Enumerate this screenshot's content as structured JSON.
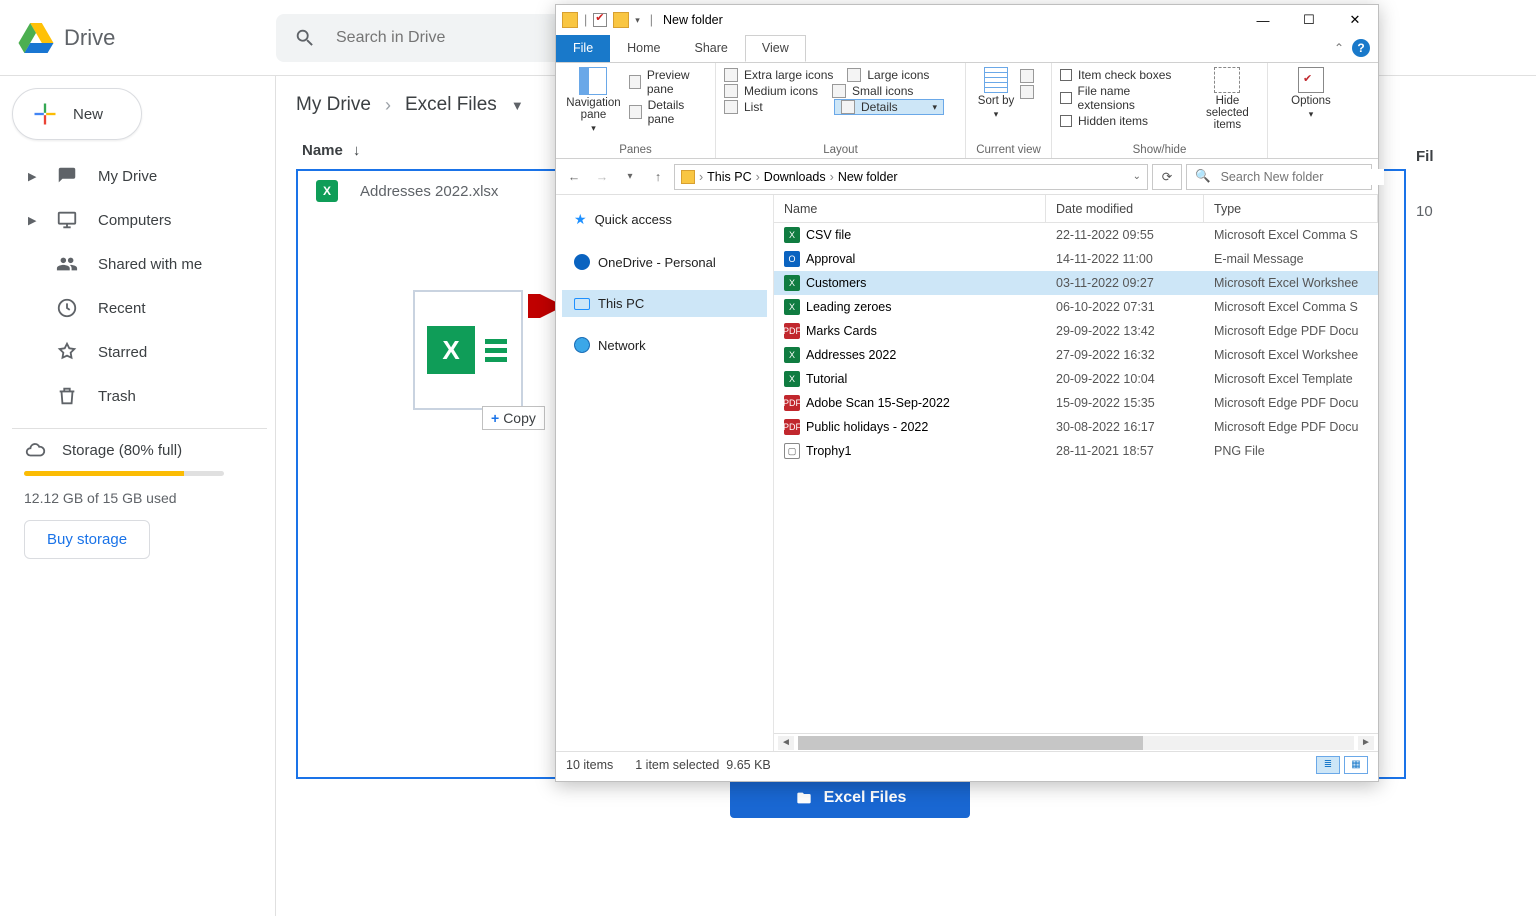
{
  "drive": {
    "brand": "Drive",
    "search_placeholder": "Search in Drive",
    "new_button": "New",
    "nav": {
      "my_drive": "My Drive",
      "computers": "Computers",
      "shared": "Shared with me",
      "recent": "Recent",
      "starred": "Starred",
      "trash": "Trash"
    },
    "storage": {
      "label": "Storage (80% full)",
      "used": "12.12 GB of 15 GB used",
      "buy": "Buy storage",
      "percent": 80
    },
    "crumbs": {
      "root": "My Drive",
      "current": "Excel Files"
    },
    "column_name": "Name",
    "right_col": {
      "header": "Fil",
      "value": "10"
    },
    "file_row": "Addresses 2022.xlsx",
    "drag_copy": "Copy",
    "drop_label": "Excel Files"
  },
  "explorer": {
    "title": "New folder",
    "tabs": {
      "file": "File",
      "home": "Home",
      "share": "Share",
      "view": "View"
    },
    "ribbon": {
      "panes": {
        "nav": "Navigation pane",
        "preview": "Preview pane",
        "details": "Details pane",
        "group": "Panes"
      },
      "layout": {
        "xl": "Extra large icons",
        "lg": "Large icons",
        "md": "Medium icons",
        "sm": "Small icons",
        "list": "List",
        "details": "Details",
        "group": "Layout"
      },
      "current": {
        "sort": "Sort by",
        "group": "Current view"
      },
      "showhide": {
        "checkboxes": "Item check boxes",
        "ext": "File name extensions",
        "hidden": "Hidden items",
        "hidesel": "Hide selected items",
        "group": "Show/hide"
      },
      "options": "Options"
    },
    "breadcrumbs": [
      "This PC",
      "Downloads",
      "New folder"
    ],
    "search_placeholder": "Search New folder",
    "tree": {
      "quick": "Quick access",
      "onedrive": "OneDrive - Personal",
      "thispc": "This PC",
      "network": "Network"
    },
    "columns": {
      "name": "Name",
      "date": "Date modified",
      "type": "Type"
    },
    "files": [
      {
        "name": "CSV file",
        "date": "22-11-2022 09:55",
        "type": "Microsoft Excel Comma S",
        "icon": "csv"
      },
      {
        "name": "Approval",
        "date": "14-11-2022 11:00",
        "type": "E-mail Message",
        "icon": "msg"
      },
      {
        "name": "Customers",
        "date": "03-11-2022 09:27",
        "type": "Microsoft Excel Workshee",
        "icon": "xls",
        "selected": true
      },
      {
        "name": "Leading zeroes",
        "date": "06-10-2022 07:31",
        "type": "Microsoft Excel Comma S",
        "icon": "csv"
      },
      {
        "name": "Marks Cards",
        "date": "29-09-2022 13:42",
        "type": "Microsoft Edge PDF Docu",
        "icon": "pdf"
      },
      {
        "name": "Addresses 2022",
        "date": "27-09-2022 16:32",
        "type": "Microsoft Excel Workshee",
        "icon": "xls"
      },
      {
        "name": "Tutorial",
        "date": "20-09-2022 10:04",
        "type": "Microsoft Excel Template",
        "icon": "xls"
      },
      {
        "name": "Adobe Scan 15-Sep-2022",
        "date": "15-09-2022 15:35",
        "type": "Microsoft Edge PDF Docu",
        "icon": "pdf"
      },
      {
        "name": "Public holidays - 2022",
        "date": "30-08-2022 16:17",
        "type": "Microsoft Edge PDF Docu",
        "icon": "pdf"
      },
      {
        "name": "Trophy1",
        "date": "28-11-2021 18:57",
        "type": "PNG File",
        "icon": "png"
      }
    ],
    "status": {
      "count": "10 items",
      "selection": "1 item selected",
      "size": "9.65 KB"
    }
  }
}
